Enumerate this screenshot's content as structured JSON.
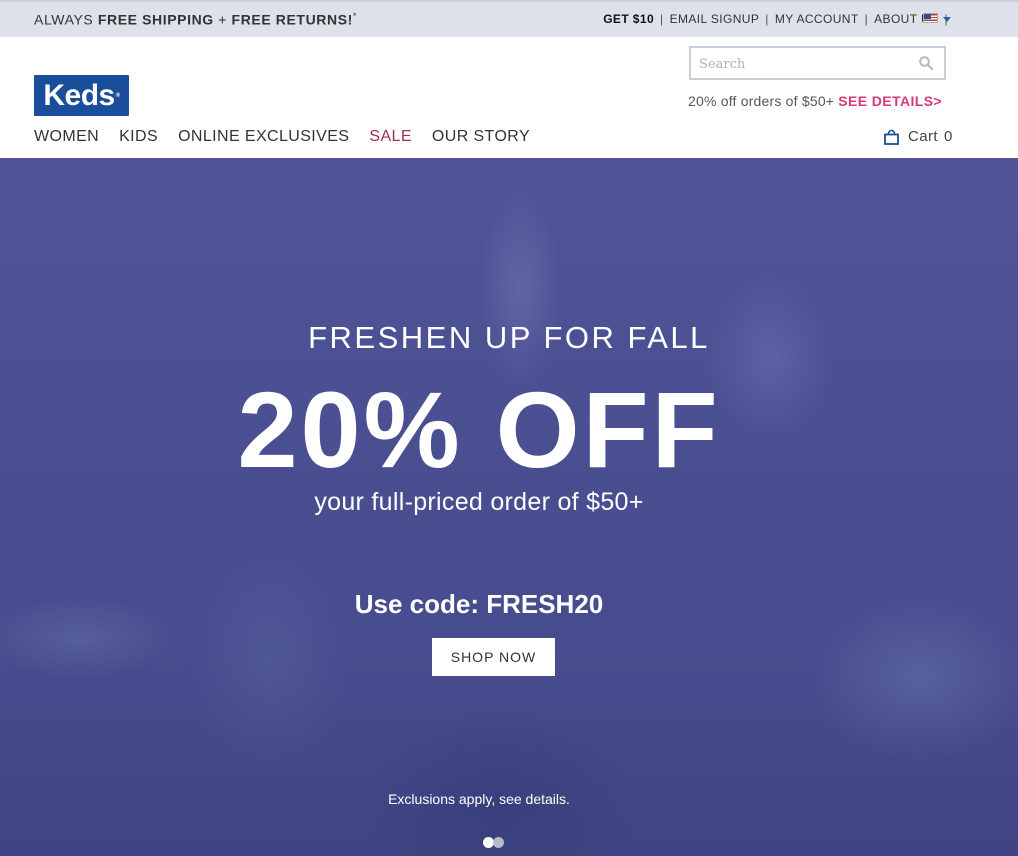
{
  "topbar": {
    "promo_prefix": "ALWAYS ",
    "promo_shipping": "FREE SHIPPING",
    "promo_plus": " + ",
    "promo_returns": "FREE RETURNS!",
    "promo_mark": "*",
    "links": [
      "GET $10",
      "EMAIL SIGNUP",
      "MY ACCOUNT",
      "ABOUT US"
    ],
    "separator": "|",
    "flag_icon": "us-flag-icon",
    "caret_icon": "caret-down-icon"
  },
  "header": {
    "logo_text": "Keds",
    "logo_mark": "®",
    "search_placeholder": "Search",
    "offer_text": "20% off orders of $50+ ",
    "offer_link": "SEE DETAILS>",
    "cart_label": "Cart",
    "cart_count": "0"
  },
  "nav": {
    "items": [
      "WOMEN",
      "KIDS",
      "ONLINE EXCLUSIVES",
      "SALE",
      "OUR STORY"
    ]
  },
  "hero": {
    "eyebrow": "FRESHEN UP FOR FALL",
    "headline": "20% OFF",
    "subheadline": "your full-priced order of $50+",
    "code_line": "Use code: FRESH20",
    "cta": "SHOP NOW",
    "exclusions": "Exclusions apply, see details.",
    "slides_total": 2,
    "active_slide": 1
  },
  "colors": {
    "accent_pink": "#d43a76",
    "sale_red": "#a62c4f",
    "brand_blue": "#1a4e9b",
    "hero_bg": "#4a4f92",
    "topbar_bg": "#dde1ea"
  }
}
